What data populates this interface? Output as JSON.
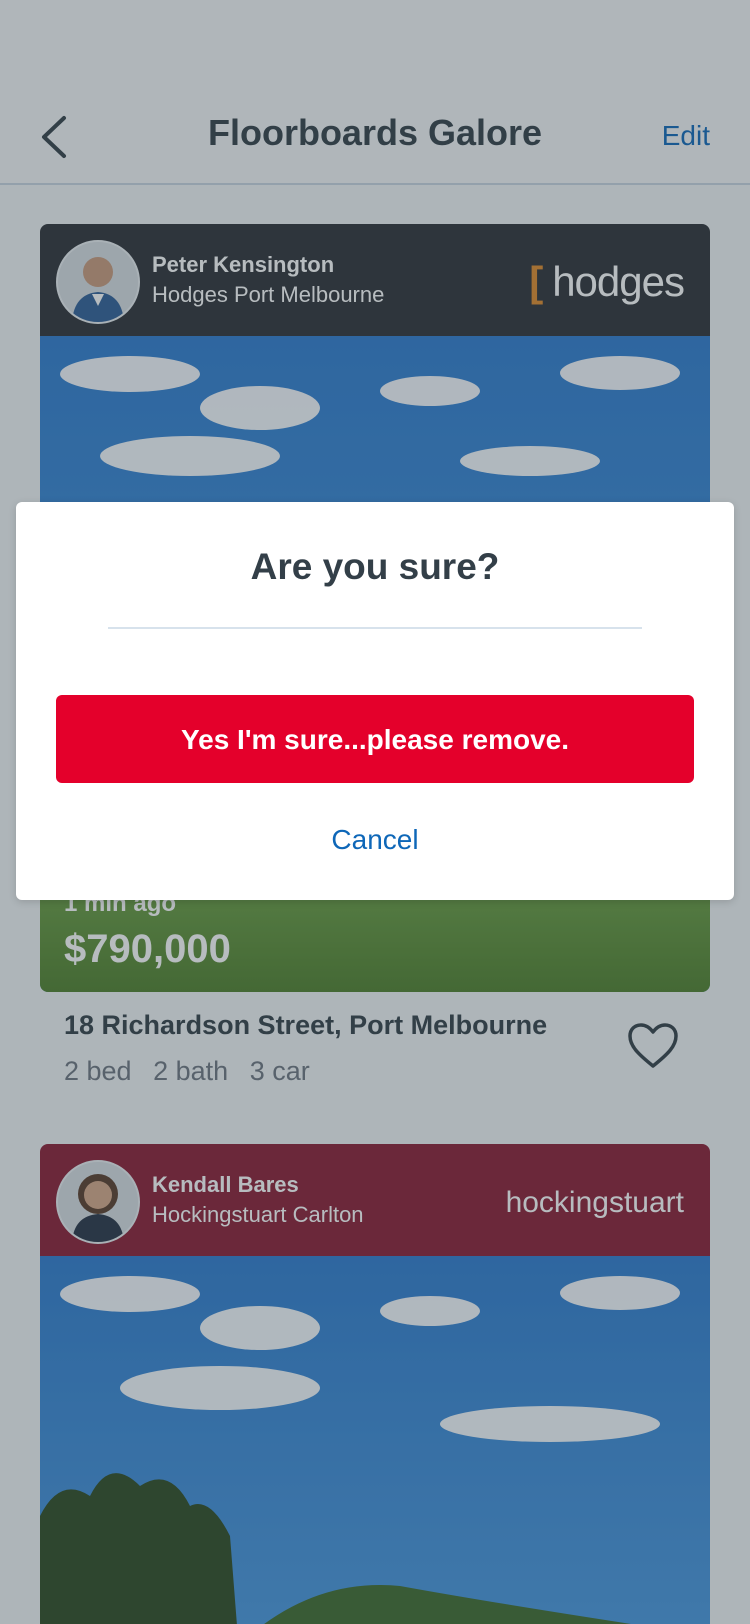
{
  "nav": {
    "title": "Floorboards Galore",
    "edit_label": "Edit"
  },
  "listings": [
    {
      "agent_name": "Peter Kensington",
      "agency": "Hodges Port Melbourne",
      "brand_logo": "hodges",
      "brand_color": "#2d3136",
      "time_ago": "1 min ago",
      "price": "$790,000",
      "address": "18 Richardson Street, Port Melbourne",
      "features": [
        "2 bed",
        "2 bath",
        "3 car"
      ]
    },
    {
      "agent_name": "Kendall Bares",
      "agency": "Hockingstuart Carlton",
      "brand_logo": "hockingstuart",
      "brand_color": "#8a1c33"
    }
  ],
  "dialog": {
    "title": "Are you sure?",
    "confirm_label": "Yes I'm sure...please remove.",
    "cancel_label": "Cancel"
  },
  "colors": {
    "accent_pink": "#e4002b",
    "link_blue": "#0e67b8",
    "text_dark": "#333f48"
  }
}
